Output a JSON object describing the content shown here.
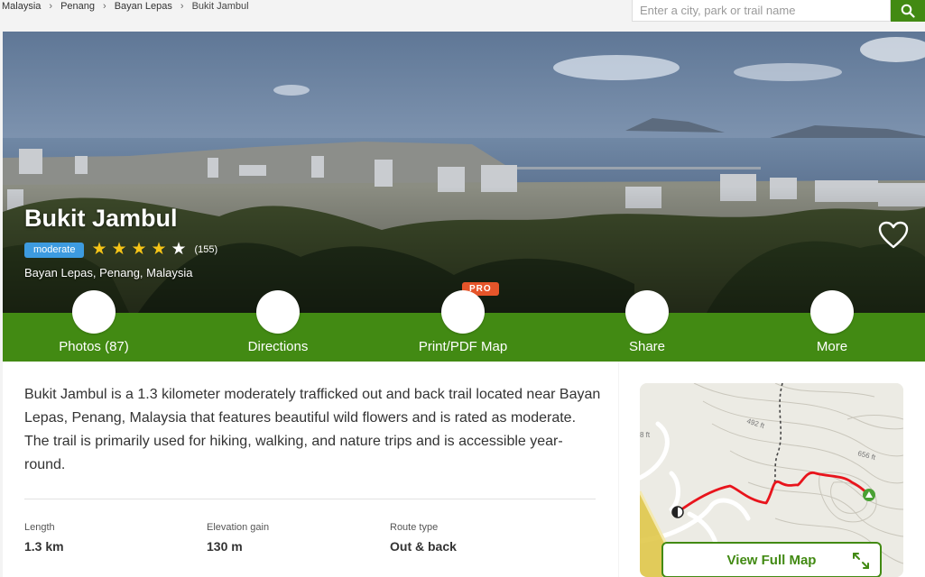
{
  "breadcrumb": [
    "Malaysia",
    "Penang",
    "Bayan Lepas",
    "Bukit Jambul"
  ],
  "breadcrumb_separator": "›",
  "search": {
    "placeholder": "Enter a city, park or trail name"
  },
  "trail": {
    "name": "Bukit Jambul",
    "difficulty": "moderate",
    "rating": 4,
    "rating_max": 5,
    "review_count": "(155)",
    "location": "Bayan Lepas, Penang, Malaysia"
  },
  "actions": [
    {
      "label": "Photos (87)"
    },
    {
      "label": "Directions"
    },
    {
      "label": "Print/PDF Map"
    },
    {
      "label": "Share"
    },
    {
      "label": "More"
    }
  ],
  "pro_badge": "PRO",
  "description": "Bukit Jambul is a 1.3 kilometer moderately trafficked out and back trail located near Bayan Lepas, Penang, Malaysia that features beautiful wild flowers and is rated as moderate. The trail is primarily used for hiking, walking, and nature trips and is accessible year-round.",
  "stats": [
    {
      "key": "Length",
      "value": "1.3 km"
    },
    {
      "key": "Elevation gain",
      "value": "130 m"
    },
    {
      "key": "Route type",
      "value": "Out & back"
    }
  ],
  "map": {
    "contour_labels": [
      "492 ft",
      "656 ft",
      "8 ft"
    ],
    "view_full_map": "View Full Map"
  },
  "colors": {
    "brand_green": "#428a13",
    "difficulty_blue": "#3d9be0",
    "pro_orange": "#e6552a",
    "trail_red": "#e8141c",
    "star_gold": "#f5c518"
  }
}
